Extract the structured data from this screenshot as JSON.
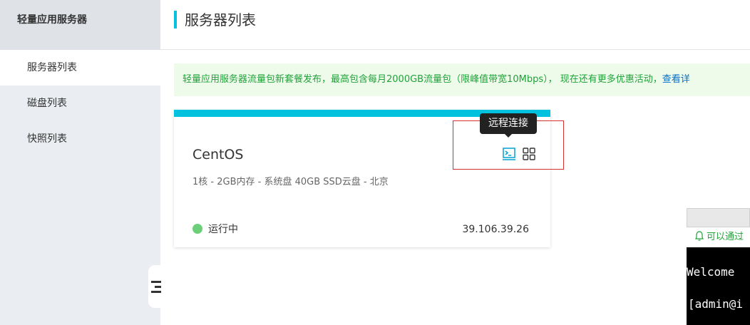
{
  "sidebar": {
    "title": "轻量应用服务器",
    "items": [
      {
        "label": "服务器列表",
        "active": true
      },
      {
        "label": "磁盘列表",
        "active": false
      },
      {
        "label": "快照列表",
        "active": false
      }
    ]
  },
  "header": {
    "title": "服务器列表"
  },
  "notice": {
    "text": "轻量应用服务器流量包新套餐发布，最高包含每月2000GB流量包（限峰值带宽10Mbps），  现在还有更多优惠活动，",
    "link": "查看详"
  },
  "server_card": {
    "name": "CentOS",
    "spec": "1核 - 2GB内存 - 系统盘 40GB SSD云盘 - 北京",
    "status": "运行中",
    "ip": "39.106.39.26",
    "tooltip": "远程连接"
  },
  "terminal": {
    "hint": "可以通过",
    "line1": "Welcome",
    "line2": "[admin@i"
  },
  "colors": {
    "accent": "#00c1de",
    "running": "#6dcf7a",
    "notice_text": "#1fa339",
    "link": "#0070cc",
    "highlight": "#d43030"
  }
}
